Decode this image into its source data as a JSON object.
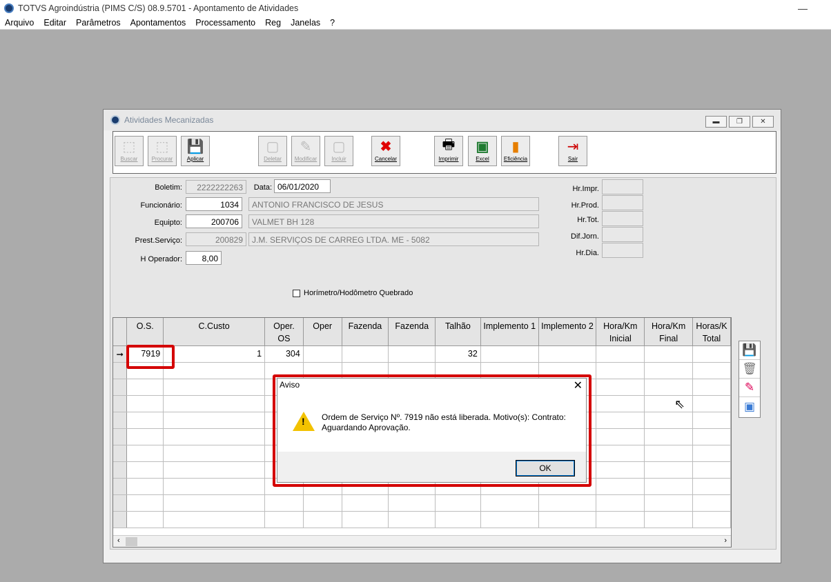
{
  "app": {
    "title": "TOTVS Agroindústria (PIMS C/S) 08.9.5701 - Apontamento de Atividades",
    "minimize": "—"
  },
  "menu": [
    "Arquivo",
    "Editar",
    "Parâmetros",
    "Apontamentos",
    "Processamento",
    "Reg",
    "Janelas",
    "?"
  ],
  "window": {
    "title": "Atividades Mecanizadas",
    "min": "▬",
    "restore": "❐",
    "close": "✕"
  },
  "toolbar": {
    "buscar": "Buscar",
    "procurar": "Procurar",
    "aplicar": "Aplicar",
    "deletar": "Deletar",
    "modificar": "Modificar",
    "incluir": "Incluir",
    "cancelar": "Cancelar",
    "imprimir": "Imprimir",
    "excel": "Excel",
    "eficiencia": "Eficiência",
    "sair": "Sair"
  },
  "form": {
    "boletim_label": "Boletim:",
    "boletim": "2222222263",
    "data_label": "Data:",
    "data": "06/01/2020",
    "funcionario_label": "Funcionário:",
    "funcionario_cod": "1034",
    "funcionario_nome": "ANTONIO FRANCISCO DE JESUS",
    "equipto_label": "Equipto:",
    "equipto_cod": "200706",
    "equipto_nome": "VALMET BH 128",
    "prest_label": "Prest.Serviço:",
    "prest_cod": "200829",
    "prest_nome": "J.M. SERVIÇOS DE CARREG LTDA.  ME - 5082",
    "hoperador_label": "H Operador:",
    "hoperador": "8,00",
    "hr_impr": "Hr.Impr.",
    "hr_prod": "Hr.Prod.",
    "hr_tot": "Hr.Tot.",
    "dif_jorn": "Dif.Jorn.",
    "hr_dia": "Hr.Dia.",
    "checkbox_label": "Horímetro/Hodômetro Quebrado"
  },
  "grid": {
    "headers": [
      [
        "O.S.",
        ""
      ],
      [
        "C.Custo",
        ""
      ],
      [
        "Oper.",
        "OS"
      ],
      [
        "Oper",
        ""
      ],
      [
        "Fazenda",
        ""
      ],
      [
        "Fazenda",
        ""
      ],
      [
        "Talhão",
        ""
      ],
      [
        "Implemento 1",
        ""
      ],
      [
        "Implemento 2",
        ""
      ],
      [
        "Hora/Km",
        "Inicial"
      ],
      [
        "Hora/Km",
        "Final"
      ],
      [
        "Horas/K",
        "Total"
      ]
    ],
    "row1": {
      "indicator": "➞",
      "os": "7919",
      "ccusto": "1",
      "operos": "304",
      "talhao": "32"
    }
  },
  "dialog": {
    "title": "Aviso",
    "close": "✕",
    "message": "Ordem de Serviço Nº. 7919 não está liberada. Motivo(s): Contrato: Aguardando Aprovação.",
    "ok": "OK",
    "warn": "!"
  }
}
